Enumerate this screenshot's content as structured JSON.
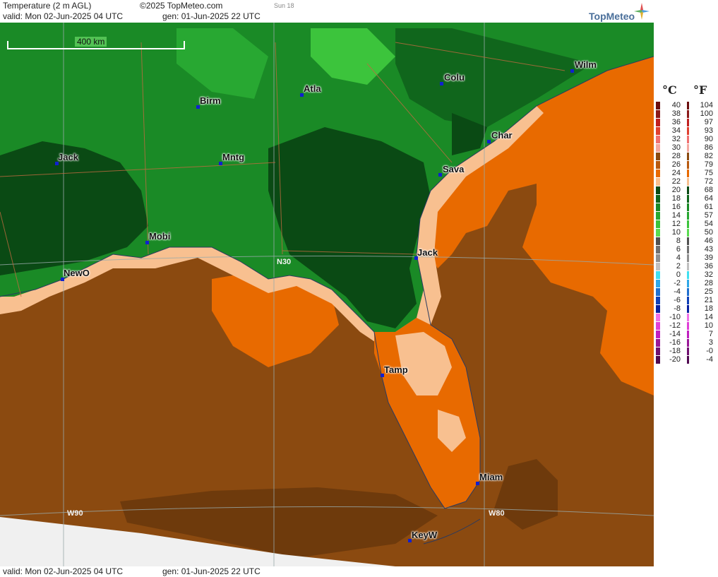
{
  "header": {
    "title": "Temperature (2 m AGL)",
    "copyright": "©2025 TopMeteo.com",
    "day": "Sun 18",
    "valid": "valid:  Mon  02-Jun-2025  04 UTC",
    "gen": "gen:  01-Jun-2025 22 UTC",
    "logo": "TopMeteo"
  },
  "footer": {
    "valid": "valid:  Mon  02-Jun-2025  04 UTC",
    "gen": "gen:  01-Jun-2025 22 UTC"
  },
  "map": {
    "scale_label": "400 km",
    "cities": [
      {
        "name": "Wilm"
      },
      {
        "name": "Colu"
      },
      {
        "name": "Atla"
      },
      {
        "name": "Birm"
      },
      {
        "name": "Char"
      },
      {
        "name": "Jack"
      },
      {
        "name": "Mntg"
      },
      {
        "name": "Sava"
      },
      {
        "name": "Mobi"
      },
      {
        "name": "Jack"
      },
      {
        "name": "NewO"
      },
      {
        "name": "Tamp"
      },
      {
        "name": "Miam"
      },
      {
        "name": "KeyW"
      }
    ],
    "coords": [
      "N30",
      "W90",
      "W80"
    ]
  },
  "legend": {
    "unit_c": "°C",
    "unit_f": "°F",
    "rows": [
      {
        "c": "40",
        "f": "104",
        "color": "#6b0f0f"
      },
      {
        "c": "38",
        "f": "100",
        "color": "#8b1a1a"
      },
      {
        "c": "36",
        "f": "97",
        "color": "#c02020"
      },
      {
        "c": "34",
        "f": "93",
        "color": "#e04030"
      },
      {
        "c": "32",
        "f": "90",
        "color": "#f07070"
      },
      {
        "c": "30",
        "f": "86",
        "color": "#f4a8a0"
      },
      {
        "c": "28",
        "f": "82",
        "color": "#8b4a10"
      },
      {
        "c": "26",
        "f": "79",
        "color": "#b85a10"
      },
      {
        "c": "24",
        "f": "75",
        "color": "#e86a00"
      },
      {
        "c": "22",
        "f": "72",
        "color": "#f8c090"
      },
      {
        "c": "20",
        "f": "68",
        "color": "#0a4a14"
      },
      {
        "c": "18",
        "f": "64",
        "color": "#10661c"
      },
      {
        "c": "16",
        "f": "61",
        "color": "#1a8a26"
      },
      {
        "c": "14",
        "f": "57",
        "color": "#28a832"
      },
      {
        "c": "12",
        "f": "54",
        "color": "#3cc43c"
      },
      {
        "c": "10",
        "f": "50",
        "color": "#5adc50"
      },
      {
        "c": "8",
        "f": "46",
        "color": "#505050"
      },
      {
        "c": "6",
        "f": "43",
        "color": "#707070"
      },
      {
        "c": "4",
        "f": "39",
        "color": "#909090"
      },
      {
        "c": "2",
        "f": "36",
        "color": "#c0c0c0"
      },
      {
        "c": "0",
        "f": "32",
        "color": "#40e0f0"
      },
      {
        "c": "-2",
        "f": "28",
        "color": "#30a8e8"
      },
      {
        "c": "-4",
        "f": "25",
        "color": "#2070d0"
      },
      {
        "c": "-6",
        "f": "21",
        "color": "#1040b8"
      },
      {
        "c": "-8",
        "f": "18",
        "color": "#0820a0"
      },
      {
        "c": "-10",
        "f": "14",
        "color": "#f070e8"
      },
      {
        "c": "-12",
        "f": "10",
        "color": "#e040d8"
      },
      {
        "c": "-14",
        "f": "7",
        "color": "#c020c0"
      },
      {
        "c": "-16",
        "f": "3",
        "color": "#9a1898"
      },
      {
        "c": "-18",
        "f": "-0",
        "color": "#701070"
      },
      {
        "c": "-20",
        "f": "-4",
        "color": "#500a50"
      }
    ]
  }
}
